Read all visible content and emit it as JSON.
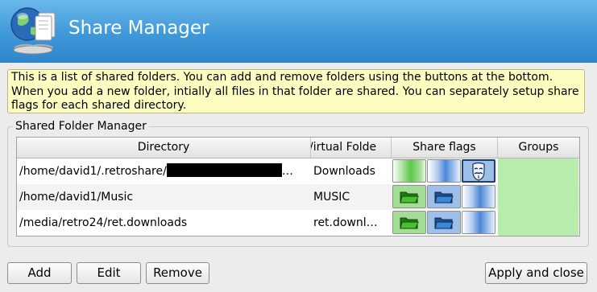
{
  "window": {
    "title": "Share Manager"
  },
  "info_text": "This is a list of shared folders. You can add and remove folders using the buttons at the bottom. When you add a new folder, intially all files in that folder are shared. You can separately setup share flags for each shared directory.",
  "group": {
    "title": "Shared Folder Manager",
    "columns": [
      "Directory",
      "/irtual Folde",
      "Share flags",
      "Groups"
    ],
    "rows": [
      {
        "directory": "/home/david1/.retroshare/",
        "directory_tail": "…",
        "virtual_folder": "Downloads",
        "flags": [
          "green-empty",
          "blue-empty",
          "anonymous-mask"
        ]
      },
      {
        "directory": "/home/david1/Music",
        "directory_tail": "",
        "virtual_folder": "MUSIC",
        "flags": [
          "green-folder",
          "blue-folder",
          "blue-empty"
        ]
      },
      {
        "directory": "/media/retro24/ret.downloads",
        "directory_tail": "",
        "virtual_folder": "ret.downl…",
        "flags": [
          "green-folder",
          "blue-folder",
          "blue-empty"
        ]
      }
    ]
  },
  "buttons": {
    "add": "Add",
    "edit": "Edit",
    "remove": "Remove",
    "apply_close": "Apply and close"
  },
  "colors": {
    "header_blue": "#3f98d8",
    "info_bg": "#fdfdc2",
    "groups_green": "#b8ecac",
    "flag_green": "#5cc94a",
    "flag_blue": "#4a86d8"
  }
}
